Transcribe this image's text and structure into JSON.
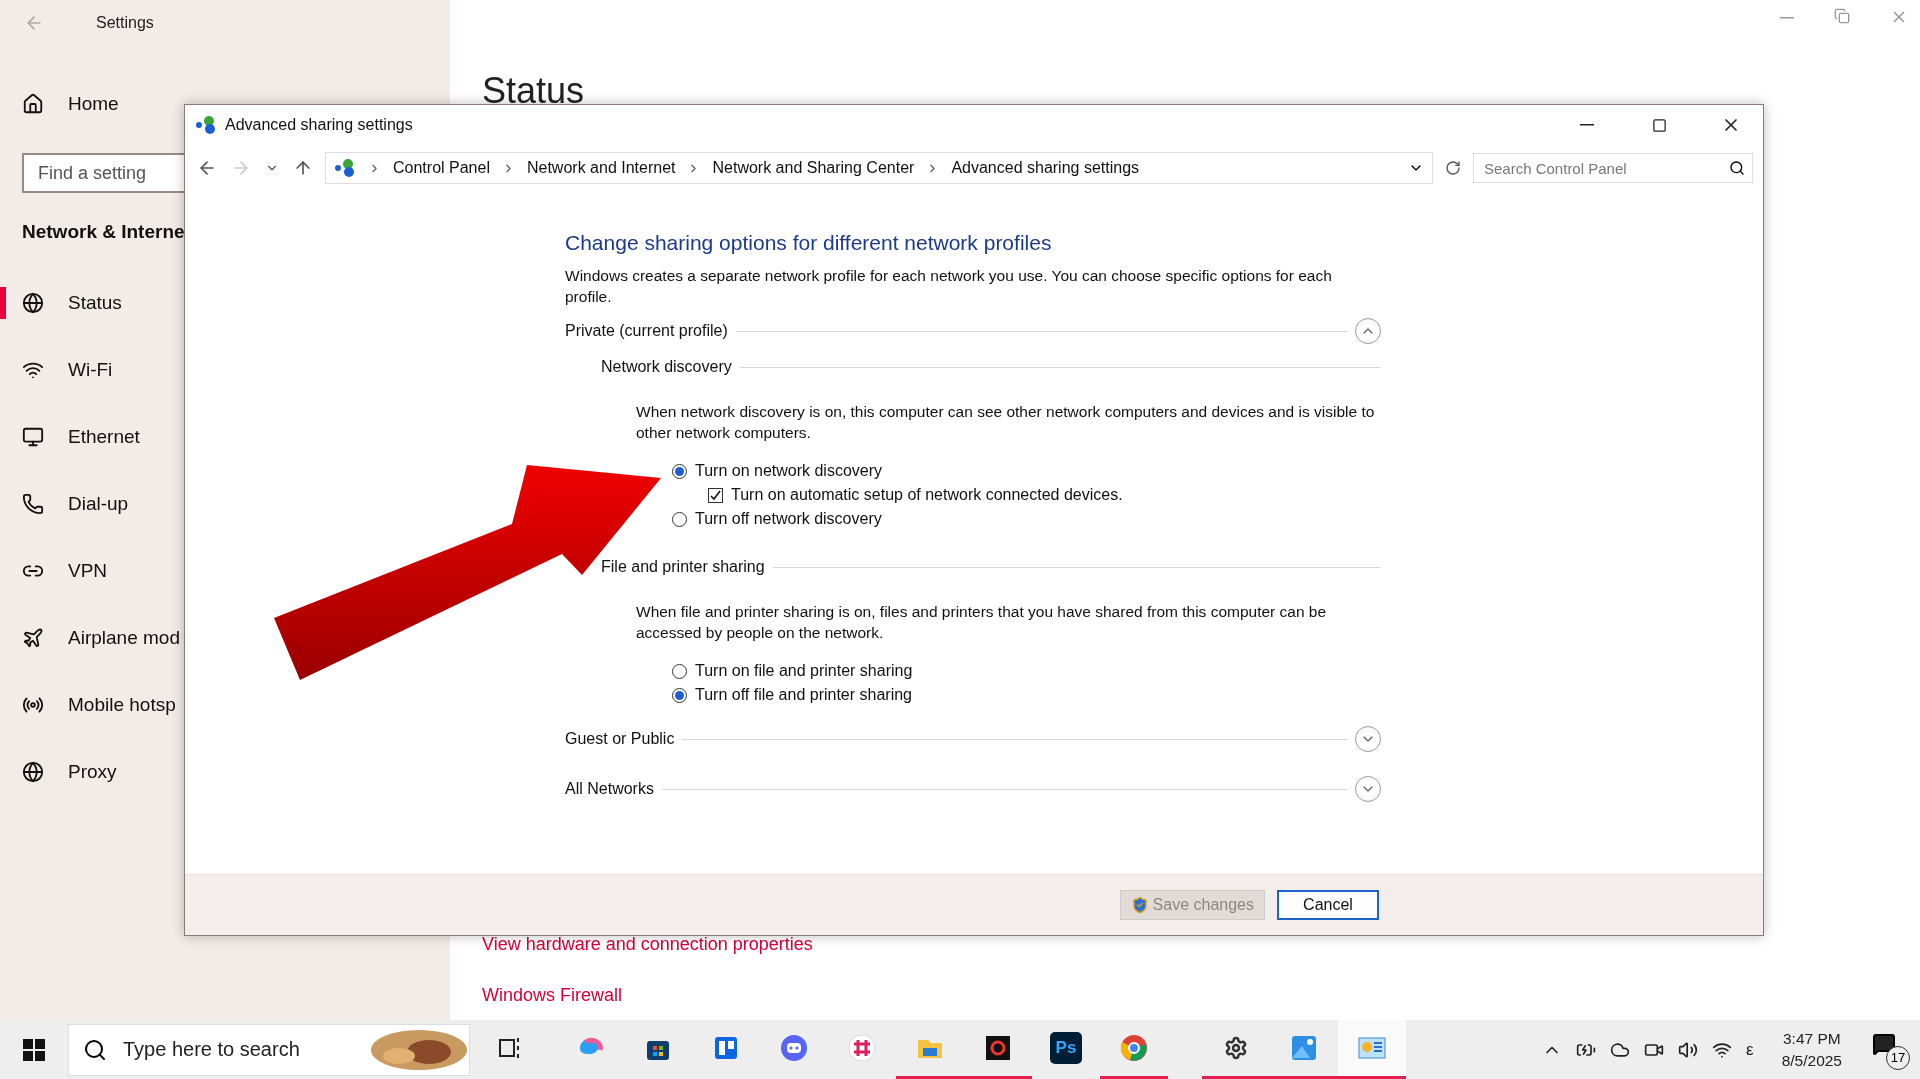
{
  "settings": {
    "title": "Settings",
    "home": "Home",
    "search": {
      "placeholder": "Find a setting"
    },
    "section": "Network & Interne",
    "nav": [
      {
        "label": "Status",
        "selected": true
      },
      {
        "label": "Wi-Fi",
        "selected": false
      },
      {
        "label": "Ethernet",
        "selected": false
      },
      {
        "label": "Dial-up",
        "selected": false
      },
      {
        "label": "VPN",
        "selected": false
      },
      {
        "label": "Airplane mod",
        "selected": false
      },
      {
        "label": "Mobile hotsp",
        "selected": false
      },
      {
        "label": "Proxy",
        "selected": false
      }
    ],
    "heading": "Status",
    "links": [
      "View hardware and connection properties",
      "Windows Firewall"
    ]
  },
  "dialog": {
    "title": "Advanced sharing settings",
    "breadcrumbs": [
      "Control Panel",
      "Network and Internet",
      "Network and Sharing Center",
      "Advanced sharing settings"
    ],
    "search": {
      "placeholder": "Search Control Panel"
    },
    "heading": "Change sharing options for different network profiles",
    "intro": "Windows creates a separate network profile for each network you use. You can choose specific options for each profile.",
    "profiles": [
      {
        "title": "Private (current profile)",
        "expanded": true,
        "groups": [
          {
            "title": "Network discovery",
            "description": "When network discovery is on, this computer can see other network computers and devices and is visible to other network computers.",
            "options": [
              {
                "label": "Turn on network discovery",
                "selected": true,
                "children": [
                  {
                    "label": "Turn on automatic setup of network connected devices.",
                    "checked": true
                  }
                ]
              },
              {
                "label": "Turn off network discovery",
                "selected": false
              }
            ]
          },
          {
            "title": "File and printer sharing",
            "description": "When file and printer sharing is on, files and printers that you have shared from this computer can be accessed by people on the network.",
            "options": [
              {
                "label": "Turn on file and printer sharing",
                "selected": false
              },
              {
                "label": "Turn off file and printer sharing",
                "selected": true
              }
            ]
          }
        ]
      },
      {
        "title": "Guest or Public",
        "expanded": false
      },
      {
        "title": "All Networks",
        "expanded": false
      }
    ],
    "buttons": [
      {
        "label": "Save changes",
        "kind": "shield",
        "disabled": true
      },
      {
        "label": "Cancel",
        "kind": "plain",
        "disabled": false
      }
    ]
  },
  "taskbar": {
    "search": {
      "placeholder": "Type here to search"
    },
    "apps": [
      {
        "open": false,
        "selected": false
      },
      {
        "open": false,
        "selected": false
      },
      {
        "open": false,
        "selected": false
      },
      {
        "open": false,
        "selected": false
      },
      {
        "open": false,
        "selected": false
      },
      {
        "open": false,
        "selected": false
      },
      {
        "open": true,
        "selected": false
      },
      {
        "open": true,
        "selected": false
      },
      {
        "open": false,
        "selected": false,
        "label": "Ps"
      },
      {
        "open": true,
        "selected": false
      },
      {
        "open": true,
        "selected": false
      },
      {
        "open": true,
        "selected": false
      },
      {
        "open": true,
        "selected": true
      }
    ],
    "language": "ε",
    "time": "3:47 PM",
    "date": "8/5/2025",
    "notifications": "17"
  }
}
